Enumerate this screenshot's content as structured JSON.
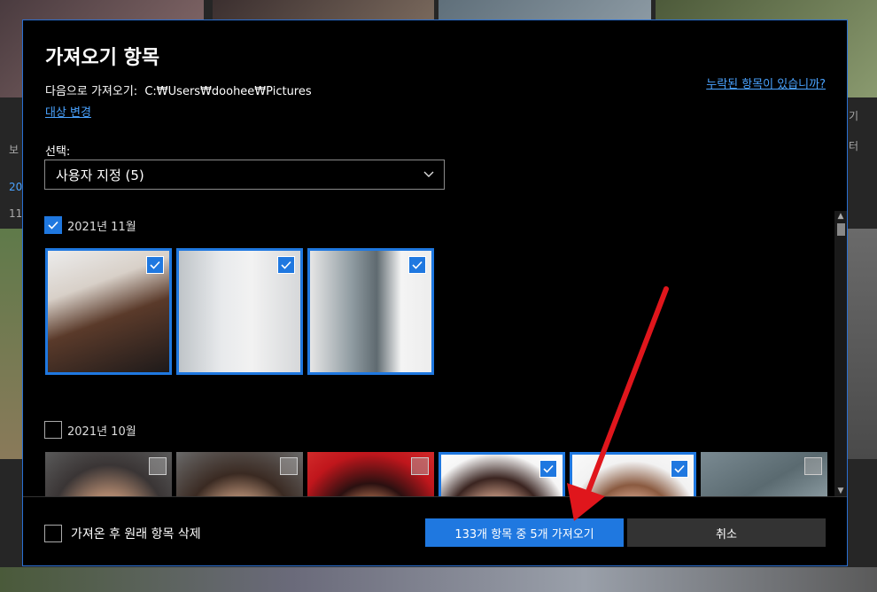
{
  "dialog": {
    "title": "가져오기 항목",
    "destination_label": "다음으로 가져오기:",
    "destination_path": "C:₩Users₩doohee₩Pictures",
    "change_link": "대상 변경",
    "missing_link": "누락된 항목이 있습니까?",
    "select_label": "선택:",
    "select_value": "사용자 지정 (5)"
  },
  "groups": [
    {
      "label": "2021년 11월",
      "checked": true,
      "items": [
        {
          "name": "photo-woman-portrait",
          "selected": true
        },
        {
          "name": "photo-office-sign",
          "selected": true
        },
        {
          "name": "photo-office-door",
          "selected": true
        }
      ]
    },
    {
      "label": "2021년 10월",
      "checked": false,
      "items": [
        {
          "name": "photo-man-portrait",
          "selected": false
        },
        {
          "name": "photo-woman-smile",
          "selected": false
        },
        {
          "name": "photo-woman-red",
          "selected": false
        },
        {
          "name": "photo-woman-earrings",
          "selected": true
        },
        {
          "name": "photo-woman-pearls",
          "selected": true
        },
        {
          "name": "photo-city-aerial",
          "selected": false
        }
      ]
    }
  ],
  "footer": {
    "delete_option": "가져온 후 원래 항목 삭제",
    "import_button": "133개 항목 중 5개 가져오기",
    "cancel_button": "취소"
  },
  "background": {
    "side_labels": [
      "보",
      "20",
      "11",
      "기",
      "터"
    ]
  },
  "colors": {
    "accent": "#1f78e0",
    "link": "#4aa3ff",
    "annotation_arrow": "#e0161c"
  }
}
